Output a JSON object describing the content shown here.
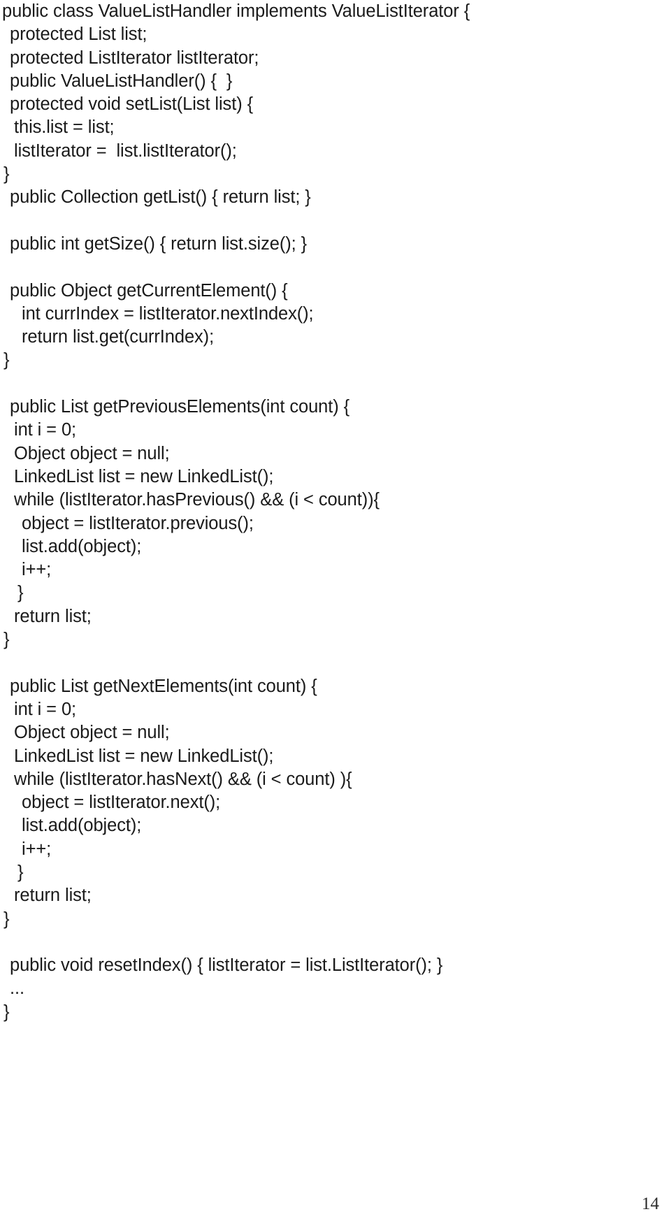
{
  "page": {
    "number": "14",
    "background_color": "#ffffff",
    "text_color": "#1a1a1a"
  },
  "code": {
    "language": "java",
    "lines": [
      {
        "text": "public class ValueListHandler implements ValueListIterator {",
        "indent": "ind-0"
      },
      {
        "text": "protected List list;",
        "indent": "ind-1"
      },
      {
        "text": "protected ListIterator listIterator;",
        "indent": "ind-1"
      },
      {
        "text": "public ValueListHandler() {  }",
        "indent": "ind-1"
      },
      {
        "text": "protected void setList(List list) {",
        "indent": "ind-1"
      },
      {
        "text": "this.list = list;",
        "indent": "ind-2"
      },
      {
        "text": "listIterator =  list.listIterator();",
        "indent": "ind-2"
      },
      {
        "text": "}",
        "indent": "ind-b0"
      },
      {
        "text": "public Collection getList() { return list; }",
        "indent": "ind-1"
      },
      {
        "text": "",
        "indent": "ind-0"
      },
      {
        "text": "public int getSize() { return list.size(); }",
        "indent": "ind-1"
      },
      {
        "text": "",
        "indent": "ind-0"
      },
      {
        "text": "public Object getCurrentElement() {",
        "indent": "ind-1"
      },
      {
        "text": "int currIndex = listIterator.nextIndex();",
        "indent": "ind-3"
      },
      {
        "text": "return list.get(currIndex);",
        "indent": "ind-3"
      },
      {
        "text": "}",
        "indent": "ind-b0"
      },
      {
        "text": "",
        "indent": "ind-0"
      },
      {
        "text": "public List getPreviousElements(int count) {",
        "indent": "ind-1"
      },
      {
        "text": "int i = 0;",
        "indent": "ind-2"
      },
      {
        "text": "Object object = null;",
        "indent": "ind-2"
      },
      {
        "text": "LinkedList list = new LinkedList();",
        "indent": "ind-2"
      },
      {
        "text": "while (listIterator.hasPrevious() && (i < count)){",
        "indent": "ind-2"
      },
      {
        "text": "object = listIterator.previous();",
        "indent": "ind-3"
      },
      {
        "text": "list.add(object);",
        "indent": "ind-3"
      },
      {
        "text": "i++;",
        "indent": "ind-3"
      },
      {
        "text": "}",
        "indent": "ind-b1"
      },
      {
        "text": "return list;",
        "indent": "ind-2"
      },
      {
        "text": "}",
        "indent": "ind-b0"
      },
      {
        "text": "",
        "indent": "ind-0"
      },
      {
        "text": "public List getNextElements(int count) {",
        "indent": "ind-1"
      },
      {
        "text": "int i = 0;",
        "indent": "ind-2"
      },
      {
        "text": "Object object = null;",
        "indent": "ind-2"
      },
      {
        "text": "LinkedList list = new LinkedList();",
        "indent": "ind-2"
      },
      {
        "text": "while (listIterator.hasNext() && (i < count) ){",
        "indent": "ind-2"
      },
      {
        "text": "object = listIterator.next();",
        "indent": "ind-3"
      },
      {
        "text": "list.add(object);",
        "indent": "ind-3"
      },
      {
        "text": "i++;",
        "indent": "ind-3"
      },
      {
        "text": "}",
        "indent": "ind-b1"
      },
      {
        "text": "return list;",
        "indent": "ind-2"
      },
      {
        "text": "}",
        "indent": "ind-b0"
      },
      {
        "text": "",
        "indent": "ind-0"
      },
      {
        "text": "public void resetIndex() { listIterator = list.ListIterator(); }",
        "indent": "ind-1"
      },
      {
        "text": "...",
        "indent": "ind-1"
      },
      {
        "text": "}",
        "indent": "ind-b0"
      }
    ]
  }
}
